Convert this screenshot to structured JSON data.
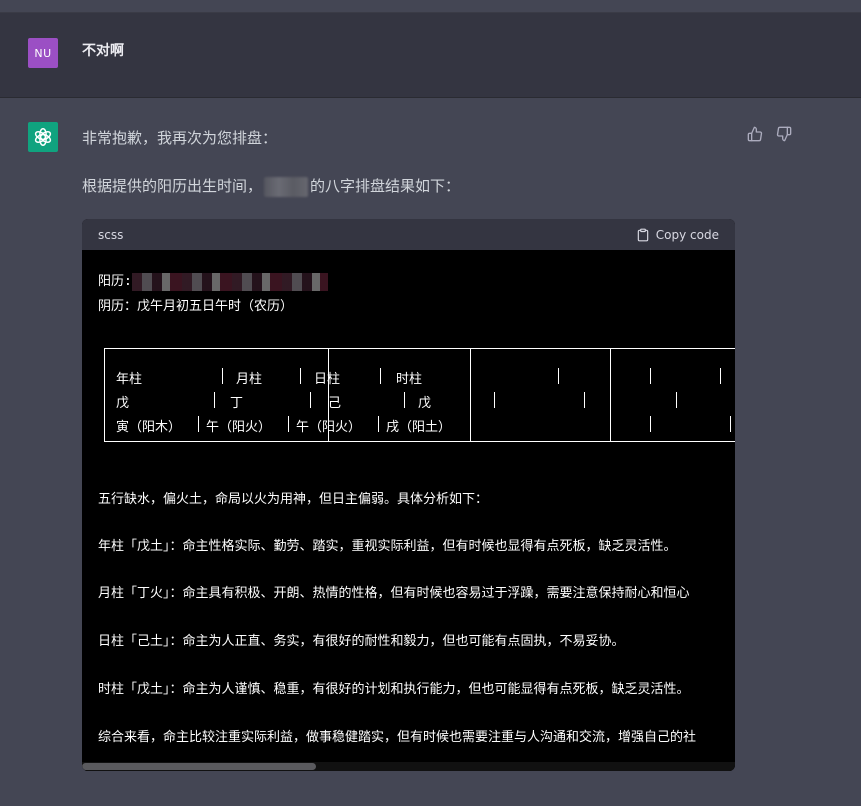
{
  "user": {
    "avatar_initials": "NU",
    "message": "不对啊"
  },
  "assistant": {
    "para1": "非常抱歉，我再次为您排盘：",
    "para2_before": "根据提供的阳历出生时间，",
    "para2_after": "的八字排盘结果如下：",
    "code": {
      "language": "scss",
      "copy_label": "Copy code",
      "solar_label": "阳历:",
      "lunar_line": "阴历：戊午月初五日午时（农历）",
      "table": {
        "header": [
          "年柱",
          "月柱",
          "日柱",
          "时柱"
        ],
        "row1": [
          "戊",
          "丁",
          "己",
          "戊"
        ],
        "row2": [
          "寅（阳木）",
          "午（阳火）",
          "午（阳火）",
          "戌（阳土）"
        ]
      },
      "lines": [
        "五行缺水，偏火土，命局以火为用神，但日主偏弱。具体分析如下：",
        "年柱「戊土」：命主性格实际、勤劳、踏实，重视实际利益，但有时候也显得有点死板，缺乏灵活性。",
        "月柱「丁火」：命主具有积极、开朗、热情的性格，但有时候也容易过于浮躁，需要注意保持耐心和恒心",
        "日柱「己土」：命主为人正直、务实，有很好的耐性和毅力，但也可能有点固执，不易妥协。",
        "时柱「戊土」：命主为人谨慎、稳重，有很好的计划和执行能力，但也可能显得有点死板，缺乏灵活性。",
        "综合来看，命主比较注重实际利益，做事稳健踏实，但有时候也需要注重与人沟通和交流，增强自己的社"
      ]
    }
  },
  "colors": {
    "user_avatar": "#9b4fc4",
    "bot_avatar": "#10a37f"
  }
}
